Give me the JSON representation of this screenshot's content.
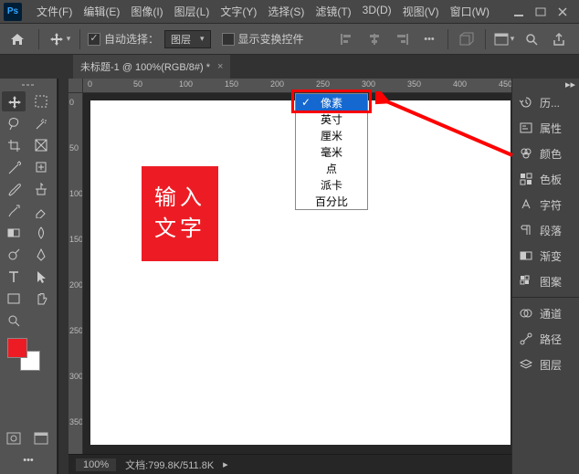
{
  "menus": [
    "文件(F)",
    "编辑(E)",
    "图像(I)",
    "图层(L)",
    "文字(Y)",
    "选择(S)",
    "滤镜(T)",
    "3D(D)",
    "视图(V)",
    "窗口(W)"
  ],
  "options": {
    "auto_select": "自动选择：",
    "auto_select_target": "图层",
    "show_transform": "显示变换控件"
  },
  "doctab": {
    "title": "未标题-1 @ 100%(RGB/8#) *"
  },
  "ruler_h": [
    "0",
    "50",
    "100",
    "150",
    "200",
    "250",
    "300",
    "350",
    "400",
    "450"
  ],
  "ruler_v": [
    "0",
    "50",
    "100",
    "150",
    "200",
    "250",
    "300",
    "350"
  ],
  "text_layer": "输入文字",
  "unit_options": [
    "像素",
    "英寸",
    "厘米",
    "毫米",
    "点",
    "派卡",
    "百分比"
  ],
  "unit_selected_index": 0,
  "status": {
    "zoom": "100%",
    "doc": "文档:799.8K/511.8K"
  },
  "panels": [
    "历...",
    "属性",
    "颜色",
    "色板",
    "字符",
    "段落",
    "渐变",
    "图案",
    "通道",
    "路径",
    "图层"
  ],
  "colors": {
    "fg": "#ed1c24",
    "bg": "#ffffff"
  }
}
